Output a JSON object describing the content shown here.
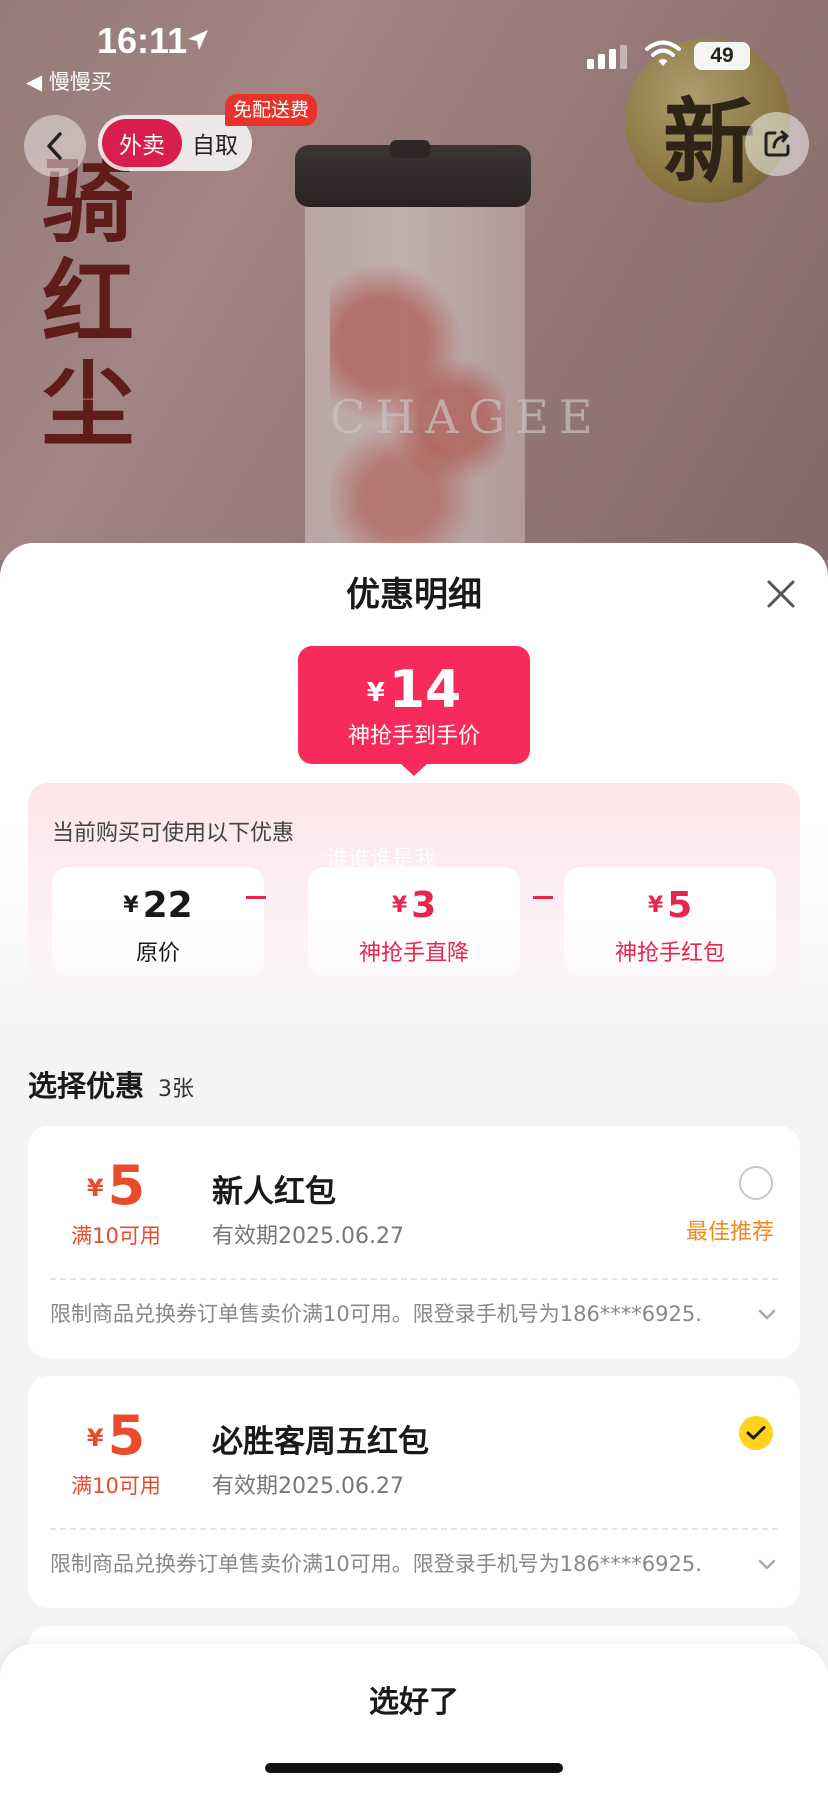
{
  "status_bar": {
    "time": "16:11",
    "back_app": "◀ 慢慢买",
    "battery": "49"
  },
  "hero": {
    "title": "骑红尘",
    "badge_char": "新",
    "cup_text": "CHAGEE"
  },
  "nav": {
    "delivery_label": "外卖",
    "pickup_label": "自取",
    "free_delivery_badge": "免配送费",
    "accent_color": "#d81e4c"
  },
  "sheet": {
    "title": "优惠明细",
    "final_price": {
      "currency": "¥",
      "amount": "14",
      "label": "神抢手到手价"
    },
    "breakdown": {
      "title": "当前购买可使用以下优惠",
      "watermark": "谁谁谁是我",
      "items": [
        {
          "currency": "¥",
          "amount": "22",
          "label": "原价"
        },
        {
          "currency": "¥",
          "amount": "3",
          "label": "神抢手直降"
        },
        {
          "currency": "¥",
          "amount": "5",
          "label": "神抢手红包"
        }
      ]
    },
    "select": {
      "heading": "选择优惠",
      "count": "3张"
    },
    "coupons": [
      {
        "currency": "¥",
        "amount": "5",
        "condition": "满10可用",
        "name": "新人红包",
        "validity": "有效期2025.06.27",
        "tag": "最佳推荐",
        "selected": false,
        "description": "限制商品兑换券订单售卖价满10可用。限登录手机号为186****6925..."
      },
      {
        "currency": "¥",
        "amount": "5",
        "condition": "满10可用",
        "name": "必胜客周五红包",
        "validity": "有效期2025.06.27",
        "tag": "",
        "selected": true,
        "description": "限制商品兑换券订单售卖价满10可用。限登录手机号为186****6925..."
      }
    ],
    "confirm_label": "选好了",
    "colors": {
      "price_red": "#f72b5b",
      "coupon_orange": "#ea4b2b",
      "tag_orange": "#f08a1d",
      "check_yellow": "#ffd21e"
    }
  }
}
